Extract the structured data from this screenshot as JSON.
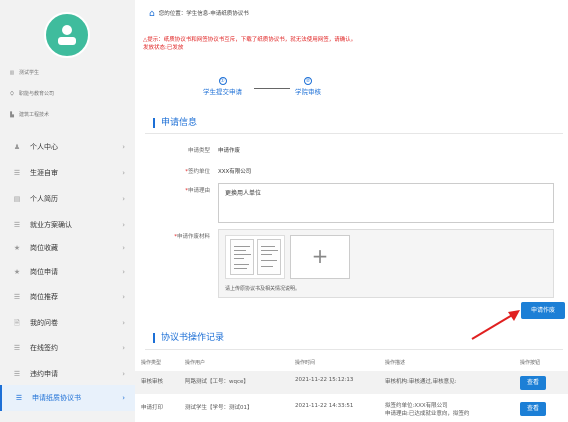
{
  "sidebar": {
    "profile": [
      {
        "icon": "bars-icon",
        "text": "测试学生"
      },
      {
        "icon": "graduation-cap-icon",
        "text": "职能与教育公司"
      },
      {
        "icon": "building-icon",
        "text": "建筑工程技术"
      }
    ],
    "items": [
      {
        "label": "个人中心",
        "icon": "user-icon"
      },
      {
        "label": "生涯自审",
        "icon": "list-icon"
      },
      {
        "label": "个人简历",
        "icon": "resume-icon"
      },
      {
        "label": "就业方案确认",
        "icon": "list-icon"
      },
      {
        "label": "岗位收藏",
        "icon": "star-icon"
      },
      {
        "label": "岗位申请",
        "icon": "star-icon"
      },
      {
        "label": "岗位推荐",
        "icon": "list-icon"
      },
      {
        "label": "我的问卷",
        "icon": "document-icon"
      },
      {
        "label": "在线签约",
        "icon": "list-icon"
      },
      {
        "label": "违约申请",
        "icon": "list-icon"
      },
      {
        "label": "申请纸质协议书",
        "icon": "list-icon"
      }
    ]
  },
  "breadcrumb": {
    "prefix": "您的位置：",
    "path": "学生信息-申请纸质协议书"
  },
  "notice": {
    "line1": "△提示：纸质协议书和网签协议书互斥，下载了纸质协议书，就无法使用网签，请确认。",
    "line2": "发放状态:已发放"
  },
  "steps": [
    {
      "num": "①",
      "label": "学生提交申请"
    },
    {
      "num": "②",
      "label": "学院审核"
    }
  ],
  "apply_info": {
    "title": "申请信息",
    "type_label": "申请类型",
    "type_value": "申请作废",
    "org_label": "签约单位",
    "org_value": "XXX有限公司",
    "reason_label": "申请理由",
    "reason_value": "更换用人单位",
    "material_label": "申请作废材料",
    "upload_note": "请上传原协议书及相关情况说明。",
    "add_symbol": "+"
  },
  "submit_button": "申请作废",
  "records": {
    "title": "协议书操作记录",
    "columns": [
      "操作类型",
      "操作用户",
      "操作时间",
      "操作描述",
      "操作按钮"
    ],
    "rows": [
      {
        "type": "审核审核",
        "user": "阿路测试【工号：wqce】",
        "time": "2021-11-22 15:12:13",
        "desc": "审核机构:审核通过,审核意见:",
        "desc2": "",
        "button": "查看"
      },
      {
        "type": "申请打印",
        "user": "测试学生【学号：测试01】",
        "time": "2021-11-22 14:33:51",
        "desc": "拟签约单位:XXX有限公司",
        "desc2": "申请理由:已达成就业意向，拟签约",
        "button": "查看"
      }
    ]
  }
}
